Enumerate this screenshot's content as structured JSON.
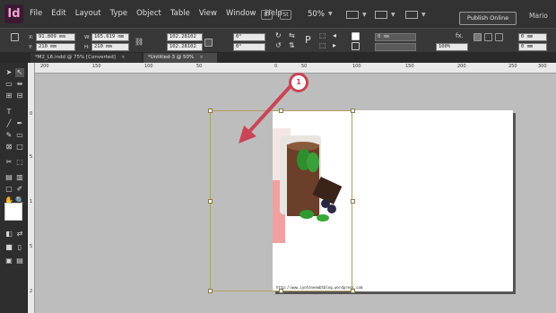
{
  "app": {
    "logo": "Id"
  },
  "menu": [
    "File",
    "Edit",
    "Layout",
    "Type",
    "Object",
    "Table",
    "View",
    "Window",
    "Help"
  ],
  "menubar": {
    "bridge": "Br",
    "stock": "St",
    "zoom": "50%",
    "publish": "Publish Online",
    "user": "Mario"
  },
  "control": {
    "x_label": "X:",
    "x": "91.809 mm",
    "y_label": "Y:",
    "y": "210 mm",
    "w_label": "W:",
    "w": "165.619 mm",
    "h_label": "H:",
    "h": "210 mm",
    "scale_x": "102.28102",
    "scale_y": "102.28102",
    "rot": "0°",
    "shear": "0°",
    "stroke_w": "0 mm",
    "opacity": "100%",
    "spacing": "0 mm",
    "offset": "0 mm"
  },
  "tabs": [
    {
      "label": "*M2_L6.indd @ 75% [Converted]",
      "close": "×",
      "active": false
    },
    {
      "label": "*Untitled-3 @ 50%",
      "close": "×",
      "active": true
    }
  ],
  "ruler": {
    "h_ticks": [
      "200",
      "150",
      "100",
      "50",
      "0",
      "50",
      "100",
      "150",
      "200",
      "250",
      "300"
    ],
    "v_ticks": [
      "0",
      "5",
      "1",
      "5",
      "2"
    ]
  },
  "annotation": {
    "step": "1",
    "arrow_color": "#c94456"
  },
  "canvas": {
    "watermark": "http://www.iyotoneewbtblog.wordpress.com"
  }
}
